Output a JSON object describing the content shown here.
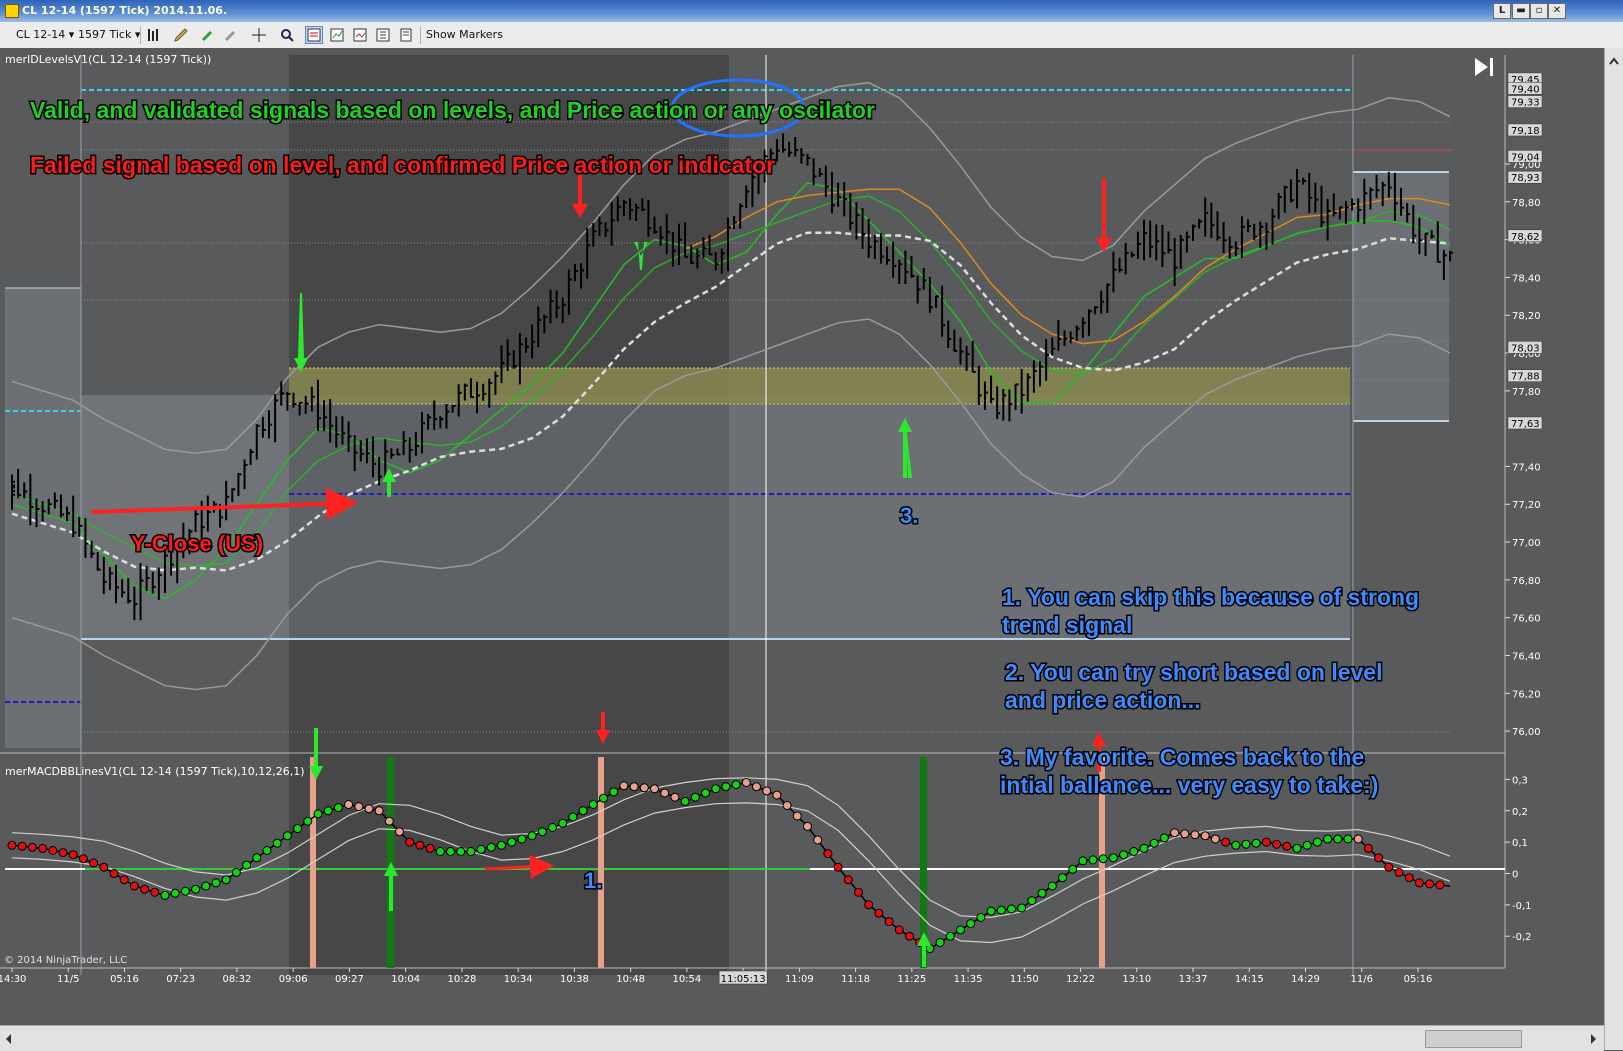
{
  "window": {
    "title": "CL 12-14 (1597 Tick)  2014.11.06.",
    "buttons": {
      "restore_small": "L",
      "minimize": "▬",
      "maximize": "▫",
      "close": "✕"
    }
  },
  "toolbar": {
    "instrument": "CL 12-14",
    "interval": "1597 Tick",
    "show_markers": "Show Markers",
    "icons": [
      "bar-style-icon",
      "draw-pencil-icon",
      "marker-icon",
      "crosshair-icon",
      "zoom-icon",
      "data-box-icon",
      "properties-icon",
      "indicators-icon",
      "strategies-icon"
    ]
  },
  "colors": {
    "panel_bg": "#5a5a5a",
    "session_dark": "#474747",
    "session_light": "#6c6f73",
    "green_text": "#21d11f",
    "red_text": "#ff1a1a",
    "blue_text": "#3d8bff",
    "cyan_level": "#35d6e3",
    "navy_level": "#1c1cc8",
    "yellow_zone": "#8a8850"
  },
  "chart_data": [
    {
      "type": "bar",
      "title": "merIDLevelsV1(CL 12-14 (1597 Tick))",
      "x_tick_labels": [
        "14:30",
        "11/5",
        "05:16",
        "07:23",
        "08:32",
        "09:06",
        "09:27",
        "10:04",
        "10:28",
        "10:34",
        "10:38",
        "10:48",
        "10:54",
        "11:05:13",
        "11:09",
        "11:18",
        "11:25",
        "11:35",
        "11:50",
        "12:22",
        "13:10",
        "13:37",
        "14:15",
        "14:29",
        "11/6",
        "05:16"
      ],
      "y_tick_labels": [
        "79,00",
        "78,80",
        "78,60",
        "78,40",
        "78,20",
        "78,00",
        "77,80",
        "77,40",
        "77,20",
        "77,00",
        "76,80",
        "76,60",
        "76,40",
        "76,20",
        "76,00"
      ],
      "y_badges": [
        "79,45",
        "79,40",
        "79,33",
        "79,18",
        "79,04",
        "78,93",
        "78,62",
        "78,03",
        "77,88",
        "77,63"
      ],
      "ylim": [
        75.9,
        79.55
      ],
      "levels": {
        "cyan_top": 79.38,
        "navy": 77.22,
        "ib_zone": [
          77.7,
          77.88
        ],
        "light_line": 76.46
      },
      "close_approx": [
        77.3,
        77.2,
        77.1,
        76.8,
        76.7,
        76.9,
        77.1,
        77.2,
        77.6,
        77.8,
        77.7,
        77.5,
        77.4,
        77.5,
        77.7,
        77.8,
        77.9,
        78.1,
        78.3,
        78.6,
        78.8,
        78.7,
        78.5,
        78.5,
        78.9,
        79.1,
        79.0,
        78.8,
        78.6,
        78.5,
        78.3,
        78.0,
        77.7,
        77.8,
        78.0,
        78.2,
        78.4,
        78.6,
        78.5,
        78.7,
        78.6,
        78.7,
        78.9,
        78.7,
        78.8,
        78.9,
        78.6,
        78.5
      ]
    },
    {
      "type": "line",
      "title": "merMACDBBLinesV1(CL 12-14 (1597 Tick),10,12,26,1)",
      "y_tick_labels": [
        "0,3",
        "0,2",
        "0,1",
        "0",
        "-0,1",
        "-0,2"
      ],
      "ylim": [
        -0.26,
        0.33
      ],
      "macd_approx": [
        0.09,
        0.08,
        0.06,
        0.02,
        -0.04,
        -0.07,
        -0.05,
        -0.02,
        0.05,
        0.12,
        0.19,
        0.22,
        0.2,
        0.1,
        0.07,
        0.07,
        0.09,
        0.12,
        0.16,
        0.22,
        0.28,
        0.27,
        0.23,
        0.27,
        0.29,
        0.25,
        0.15,
        0.02,
        -0.1,
        -0.18,
        -0.24,
        -0.18,
        -0.12,
        -0.11,
        -0.04,
        0.04,
        0.05,
        0.08,
        0.13,
        0.12,
        0.09,
        0.1,
        0.08,
        0.11,
        0.11,
        0.02,
        -0.03,
        -0.04
      ]
    }
  ],
  "annotations": {
    "valid_signals": "Valid, and validated signals based on levels, and Price action or any oscilator",
    "failed_signal": "Failed signal based on level, and confirmed Price action or indicator",
    "y_close": "Y-Close (US)",
    "label_3": "3.",
    "label_1": "1.",
    "note_1": [
      "1. You can skip this because of strong",
      "trend signal"
    ],
    "note_2": [
      "2. You can try short based on level",
      "and price action..."
    ],
    "note_3": [
      "3. My favorite. Comes back to the",
      "intial ballance... very easy to take:)"
    ]
  },
  "copyright": "© 2014 NinjaTrader, LLC"
}
